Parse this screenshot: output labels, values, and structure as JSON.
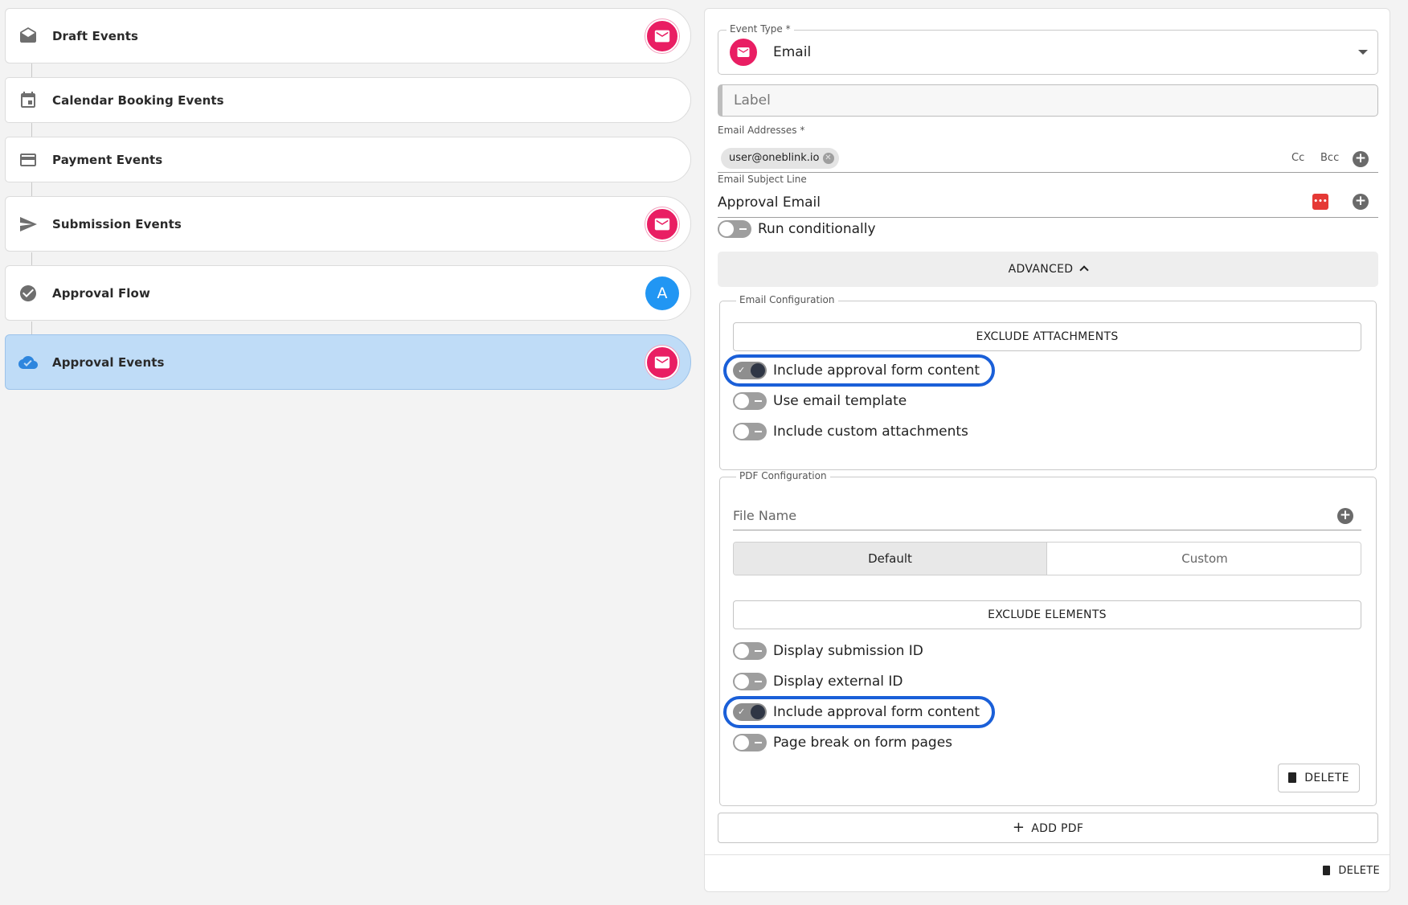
{
  "events": [
    {
      "label": "Draft Events",
      "icon": "envelope-open-icon",
      "badge": "mail"
    },
    {
      "label": "Calendar Booking Events",
      "icon": "calendar-icon",
      "badge": null
    },
    {
      "label": "Payment Events",
      "icon": "credit-card-icon",
      "badge": null
    },
    {
      "label": "Submission Events",
      "icon": "send-icon",
      "badge": "mail"
    },
    {
      "label": "Approval Flow",
      "icon": "check-circle-icon",
      "badge": "A"
    },
    {
      "label": "Approval Events",
      "icon": "cloud-check-icon",
      "badge": "mail",
      "selected": true
    }
  ],
  "form": {
    "event_type_label": "Event Type *",
    "event_type_value": "Email",
    "label_placeholder": "Label",
    "email_addresses_label": "Email Addresses *",
    "email_chip": "user@oneblink.io",
    "cc": "Cc",
    "bcc": "Bcc",
    "subject_label": "Email Subject Line",
    "subject_value": "Approval Email",
    "run_conditionally": "Run conditionally",
    "advanced": "ADVANCED"
  },
  "email_config": {
    "legend": "Email Configuration",
    "exclude_attachments": "EXCLUDE ATTACHMENTS",
    "toggles": [
      {
        "label": "Include approval form content",
        "on": true,
        "highlighted": true
      },
      {
        "label": "Use email template",
        "on": false
      },
      {
        "label": "Include custom attachments",
        "on": false
      }
    ]
  },
  "pdf_config": {
    "legend": "PDF Configuration",
    "file_name_placeholder": "File Name",
    "segment_default": "Default",
    "segment_custom": "Custom",
    "exclude_elements": "EXCLUDE ELEMENTS",
    "toggles": [
      {
        "label": "Display submission ID",
        "on": false
      },
      {
        "label": "Display external ID",
        "on": false
      },
      {
        "label": "Include approval form content",
        "on": true,
        "highlighted": true
      },
      {
        "label": "Page break on form pages",
        "on": false
      }
    ],
    "delete": "DELETE"
  },
  "add_pdf": "ADD PDF",
  "footer_delete": "DELETE",
  "colors": {
    "accent_pink": "#e91e63",
    "accent_blue": "#2196f3",
    "selected_bg": "#bfdcf7",
    "highlight": "#1a5fd8"
  }
}
